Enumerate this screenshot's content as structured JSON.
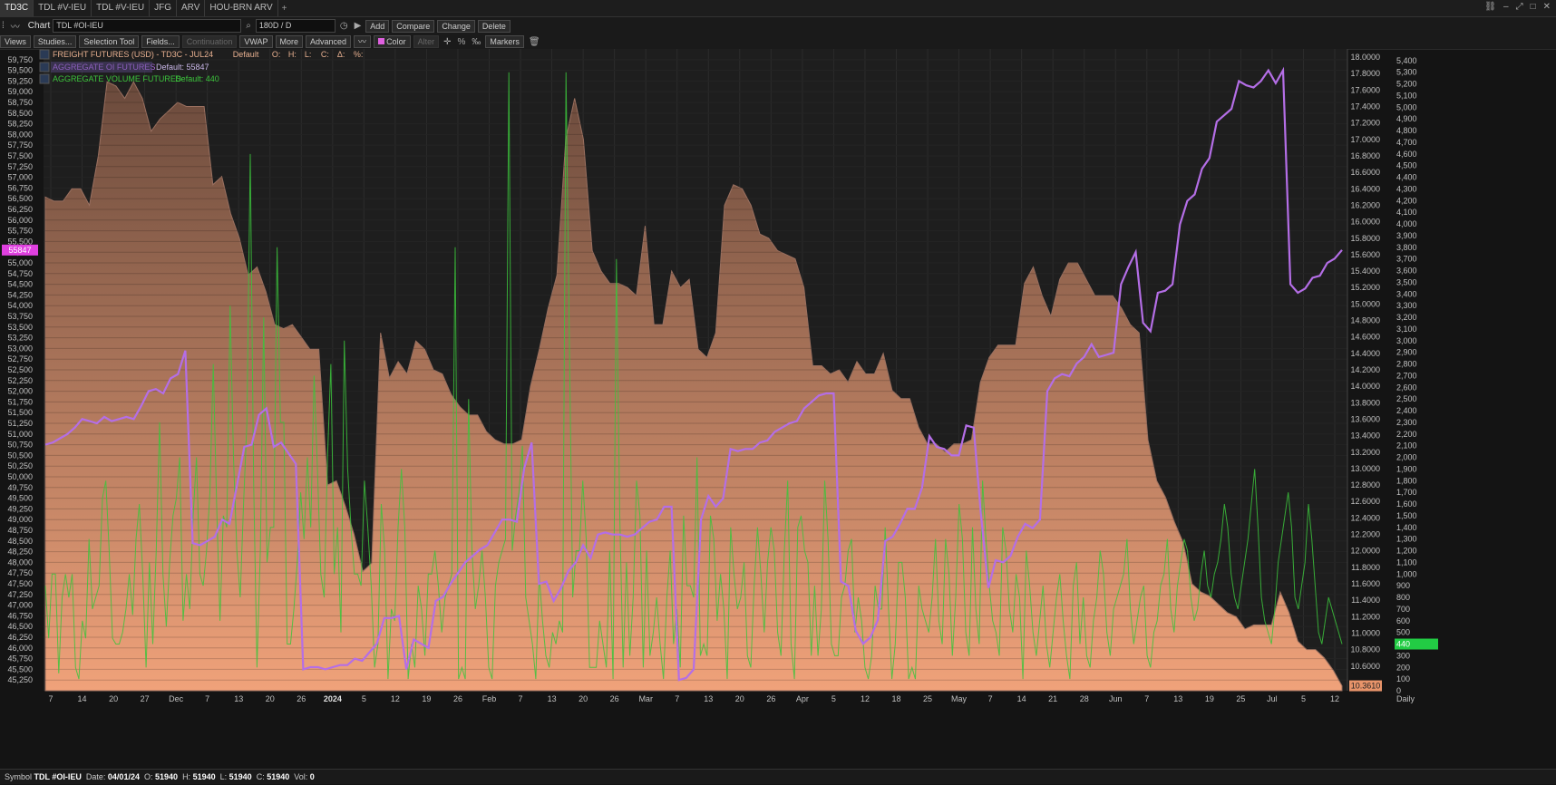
{
  "tabs": [
    "TD3C",
    "TDL #V-IEU",
    "TDL #V-IEU",
    "JFG",
    "ARV",
    "HOU-BRN ARV"
  ],
  "tab_add": "+",
  "window_title": "Chart",
  "symbol_input": "TDL #OI-IEU",
  "period_select": "180D / D",
  "toolbar_buttons": {
    "add": "Add",
    "compare": "Compare",
    "change": "Change",
    "delete": "Delete"
  },
  "toolbar2": {
    "views": "Views",
    "studies": "Studies...",
    "selection_tool": "Selection Tool",
    "fields": "Fields...",
    "continuation": "Continuation",
    "vwap": "VWAP",
    "more": "More",
    "advanced": "Advanced",
    "color": "Color",
    "alter": "Alter",
    "percent": "%",
    "markers": "Markers"
  },
  "legend": {
    "freight_name": "FREIGHT FUTURES (USD) - TD3C - JUL24",
    "freight_default": "Default",
    "freight_fields": [
      "O:",
      "H:",
      "L:",
      "C:",
      "Δ:",
      "%:"
    ],
    "oi_name": "AGGREGATE OI FUTURES",
    "oi_default": "Default: 55847",
    "vol_name": "AGGREGATE VOLUME FUTURES",
    "vol_default": "Default: 440"
  },
  "price_tags": {
    "left": "55847",
    "right_vol": "440",
    "right_freight": "10.3610"
  },
  "period_label": "Daily",
  "status": {
    "symbol_label": "Symbol",
    "symbol": "TDL #OI-IEU",
    "date_label": "Date:",
    "date": "04/01/24",
    "o_label": "O:",
    "o": "51940",
    "h_label": "H:",
    "h": "51940",
    "l_label": "L:",
    "l": "51940",
    "c_label": "C:",
    "c": "51940",
    "vol_label": "Vol:",
    "vol": "0"
  },
  "colors": {
    "background": "#1e1e1e",
    "area_top": "#6a4a3c",
    "area_bottom": "#f0a27a",
    "oi_line": "#b46ee6",
    "vol_line": "#3cc43c",
    "oi_tag": "#e040e0",
    "vol_tag": "#22cc44"
  },
  "chart_data": {
    "type": "line",
    "x_labels": [
      "7",
      "14",
      "20",
      "27",
      "Dec",
      "7",
      "13",
      "20",
      "26",
      "2024",
      "5",
      "12",
      "19",
      "26",
      "Feb",
      "7",
      "13",
      "20",
      "26",
      "Mar",
      "7",
      "13",
      "20",
      "26",
      "Apr",
      "5",
      "12",
      "18",
      "25",
      "May",
      "7",
      "14",
      "21",
      "28",
      "Jun",
      "7",
      "13",
      "19",
      "25",
      "Jul",
      "5",
      "12"
    ],
    "left_axis": {
      "min": 45000,
      "max": 60000,
      "step": 250,
      "label_from": 45250,
      "label_to": 59750
    },
    "right_freight_axis": {
      "min": 10.3,
      "max": 18.1,
      "step": 0.2,
      "label_from": 10.6,
      "label_to": 18.0
    },
    "right_volume_axis": {
      "min": 0,
      "max": 5500,
      "step": 100,
      "label_from": 0,
      "label_to": 5400
    },
    "series": [
      {
        "name": "FREIGHT FUTURES (USD) - TD3C - JUL24",
        "type": "area",
        "axis": "right_freight",
        "values": [
          16.3,
          16.25,
          16.25,
          16.4,
          16.4,
          16.2,
          16.8,
          17.7,
          17.65,
          17.5,
          17.7,
          17.5,
          17.1,
          17.25,
          17.35,
          17.45,
          17.4,
          17.4,
          17.4,
          16.45,
          16.55,
          16.1,
          15.8,
          15.35,
          15.45,
          15.15,
          14.75,
          14.7,
          14.75,
          14.6,
          14.45,
          14.45,
          12.8,
          12.85,
          12.55,
          12.2,
          11.75,
          11.85,
          14.65,
          14.1,
          14.3,
          14.15,
          14.55,
          14.45,
          14.2,
          14.15,
          13.9,
          13.75,
          13.65,
          13.65,
          13.45,
          13.35,
          13.3,
          13.3,
          13.35,
          14.0,
          14.45,
          14.95,
          15.35,
          17.0,
          17.5,
          17.0,
          15.65,
          15.4,
          15.25,
          15.25,
          15.2,
          15.1,
          15.95,
          14.75,
          14.75,
          15.4,
          15.2,
          15.3,
          14.45,
          14.35,
          14.65,
          16.2,
          16.45,
          16.4,
          16.2,
          15.85,
          15.8,
          15.65,
          15.6,
          15.55,
          15.2,
          14.25,
          14.25,
          14.15,
          14.2,
          14.05,
          14.3,
          14.15,
          14.15,
          14.4,
          13.95,
          13.85,
          13.85,
          13.5,
          13.3,
          13.3,
          13.2,
          13.3,
          13.3,
          13.35,
          14.05,
          14.35,
          14.5,
          14.5,
          14.5,
          15.25,
          15.45,
          15.1,
          14.85,
          15.3,
          15.5,
          15.5,
          15.3,
          15.1,
          15.1,
          15.1,
          14.95,
          14.75,
          14.65,
          13.35,
          12.85,
          12.65,
          12.35,
          12.1,
          11.6,
          11.5,
          11.45,
          11.35,
          11.25,
          11.2,
          11.05,
          11.1,
          11.1,
          11.1,
          11.5,
          11.25,
          10.9,
          10.8,
          10.8,
          10.7,
          10.55,
          10.36
        ]
      },
      {
        "name": "AGGREGATE OI FUTURES",
        "type": "line",
        "axis": "left",
        "values": [
          50750,
          50800,
          50900,
          51000,
          51150,
          51350,
          51300,
          51250,
          51400,
          51300,
          51350,
          51400,
          51350,
          51650,
          52000,
          52050,
          51950,
          52300,
          52400,
          52950,
          48450,
          48400,
          48500,
          48600,
          49000,
          48900,
          49800,
          50700,
          50750,
          51450,
          51600,
          50700,
          50800,
          50550,
          50300,
          45500,
          45550,
          45550,
          45500,
          45550,
          45600,
          45600,
          45750,
          45700,
          45900,
          46100,
          46700,
          46700,
          46750,
          45500,
          46200,
          46100,
          46000,
          47100,
          47200,
          47500,
          47750,
          48000,
          48150,
          48300,
          48400,
          48700,
          49000,
          49000,
          48950,
          50200,
          50800,
          47500,
          47550,
          47100,
          47400,
          47800,
          48000,
          48400,
          48100,
          48650,
          48700,
          48650,
          48650,
          48600,
          48650,
          48800,
          48950,
          49000,
          49300,
          49300,
          45250,
          45300,
          45500,
          49000,
          49550,
          49300,
          49500,
          50650,
          50600,
          50650,
          50650,
          50800,
          50850,
          51050,
          51150,
          51250,
          51300,
          51600,
          51750,
          51900,
          51950,
          51950,
          47550,
          47450,
          46400,
          46100,
          46250,
          46650,
          48500,
          48600,
          48900,
          49250,
          49250,
          49750,
          50950,
          50700,
          50650,
          50500,
          50500,
          51200,
          51150,
          49100,
          47400,
          48050,
          48000,
          48150,
          48600,
          48900,
          48800,
          49000,
          52000,
          52300,
          52400,
          52350,
          52650,
          52800,
          53100,
          52800,
          52850,
          52900,
          54500,
          54900,
          55250,
          53600,
          53400,
          54300,
          54350,
          54500,
          55900,
          56450,
          56600,
          57200,
          57450,
          58300,
          58450,
          58600,
          59250,
          59150,
          59100,
          59250,
          59500,
          59200,
          59500,
          54500,
          54300,
          54400,
          54650,
          54700,
          55000,
          55100,
          55300
        ]
      },
      {
        "name": "AGGREGATE VOLUME FUTURES",
        "type": "line",
        "axis": "right_volume",
        "values": [
          900,
          450,
          1000,
          1000,
          150,
          800,
          1000,
          800,
          1000,
          200,
          100,
          600,
          450,
          1300,
          700,
          800,
          900,
          1650,
          1800,
          1200,
          450,
          400,
          400,
          500,
          700,
          1000,
          650,
          1300,
          1600,
          1000,
          200,
          1100,
          400,
          1200,
          2300,
          1000,
          550,
          1100,
          1500,
          1650,
          2000,
          600,
          1000,
          700,
          1500,
          2000,
          1000,
          900,
          1200,
          1700,
          2800,
          1600,
          600,
          1500,
          1400,
          3300,
          2000,
          1200,
          800,
          1600,
          2300,
          4600,
          1800,
          200,
          1200,
          3200,
          1100,
          1400,
          1400,
          3800,
          2300,
          2300,
          400,
          400,
          700,
          1100,
          1700,
          1300,
          2000,
          1400,
          2700,
          1900,
          1000,
          800,
          2000,
          2800,
          1000,
          1400,
          500,
          3000,
          1900,
          1400,
          1000,
          1000,
          900,
          1800,
          1400,
          900,
          200,
          400,
          1600,
          1200,
          100,
          700,
          600,
          1400,
          1900,
          1400,
          100,
          400,
          200,
          900,
          700,
          300,
          1000,
          1000,
          1200,
          900,
          500,
          800,
          900,
          1000,
          3800,
          100,
          200,
          100,
          2500,
          1200,
          700,
          900,
          1200,
          800,
          200,
          100,
          900,
          1100,
          1200,
          1300,
          5300,
          1200,
          1500,
          1700,
          2100,
          800,
          600,
          400,
          100,
          1000,
          600,
          300,
          200,
          500,
          400,
          600,
          500,
          5300,
          3000,
          800,
          1200,
          1200,
          1800,
          1300,
          200,
          200,
          200,
          600,
          400,
          200,
          1200,
          100,
          3700,
          1500,
          200,
          1100,
          300,
          800,
          1800,
          1500,
          200,
          1200,
          300,
          500,
          800,
          400,
          100,
          800,
          1200,
          400,
          700,
          200,
          1500,
          900,
          900,
          800,
          2000,
          300,
          400,
          300,
          1500,
          1300,
          600,
          1000,
          700,
          100,
          1400,
          1000,
          700,
          800,
          1100,
          300,
          200,
          900,
          1400,
          1000,
          500,
          1100,
          1400,
          1200,
          500,
          300,
          1200,
          1800,
          400,
          100,
          1400,
          1500,
          1200,
          1100,
          300,
          900,
          300,
          700,
          1800,
          1300,
          400,
          300,
          300,
          800,
          900,
          1200,
          1300,
          500,
          800,
          600,
          200,
          100,
          300,
          900,
          700,
          700,
          1400,
          700,
          100,
          400,
          1100,
          1100,
          800,
          100,
          200,
          100,
          900,
          700,
          600,
          500,
          800,
          1300,
          600,
          400,
          1300,
          1000,
          300,
          800,
          1600,
          1300,
          500,
          300,
          1400,
          700,
          400,
          1800,
          1300,
          900,
          600,
          500,
          300,
          1400,
          1200,
          700,
          500,
          1000,
          800,
          100,
          1200,
          900,
          500,
          300,
          600,
          900,
          400,
          200,
          500,
          800,
          1000,
          600,
          300,
          100,
          900,
          1100,
          400,
          800,
          300,
          200,
          600,
          800,
          1200,
          1000,
          500,
          300,
          700,
          800,
          900,
          1000,
          1300,
          700,
          400,
          600,
          800,
          900,
          300,
          200,
          500,
          600,
          900,
          1000,
          1300,
          700,
          500,
          900,
          1100,
          1300,
          1200,
          800,
          600,
          700,
          1000,
          1200,
          900,
          800,
          1000,
          1100,
          1300,
          1600,
          1400,
          1000,
          800,
          700,
          900,
          1100,
          1300,
          1600,
          1900,
          1400,
          800,
          600,
          500,
          400,
          700,
          1100,
          1300,
          1500,
          1700,
          1400,
          800,
          700,
          900,
          1100,
          1600,
          1300,
          900,
          500,
          400,
          600,
          800,
          700,
          600,
          500,
          400
        ]
      }
    ]
  }
}
